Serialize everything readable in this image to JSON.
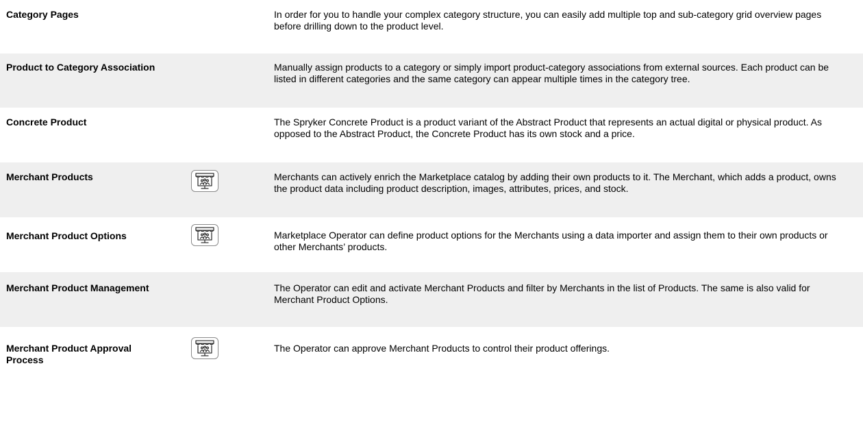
{
  "features": [
    {
      "name": "Category Pages",
      "description": "In order for you to handle your complex category structure, you can easily add multiple top and sub-category grid overview pages before drilling down to the product level.",
      "marketplace": false
    },
    {
      "name": "Product to Category Association",
      "description": "Manually assign products to a category or simply import product-category associations from external sources. Each product can be listed in different categories and the same category can appear multiple times in the category tree.",
      "marketplace": false
    },
    {
      "name": "Concrete Product",
      "description": "The Spryker Concrete Product is a product variant of the Abstract Product that represents an actual digital or physical product. As opposed to the Abstract Product, the Concrete Product has its own stock and a price.",
      "marketplace": false
    },
    {
      "name": "Merchant Products",
      "description": "Merchants can actively enrich the Marketplace catalog by adding their own products to it. The Merchant, which adds a product, owns the product data including product description, images, attributes, prices, and stock.",
      "marketplace": true
    },
    {
      "name": "Merchant Product Options",
      "description": "Marketplace Operator can define product options for the Merchants using a data importer and assign them to their own products or other Merchants’ products.",
      "marketplace": true
    },
    {
      "name": "Merchant Product Management",
      "description": "The Operator can edit and activate Merchant Products and filter by Merchants in the list of Products. The same is also valid for Merchant Product Options.",
      "marketplace": false
    },
    {
      "name": "Merchant Product Approval Process",
      "description": "The Operator can approve Merchant Products to control their product offerings.",
      "marketplace": true
    }
  ],
  "icons": {
    "marketplace": "marketplace-storefront-icon"
  },
  "colors": {
    "shaded_row": "#efefef",
    "text": "#000000",
    "icon_stroke": "#333333"
  }
}
